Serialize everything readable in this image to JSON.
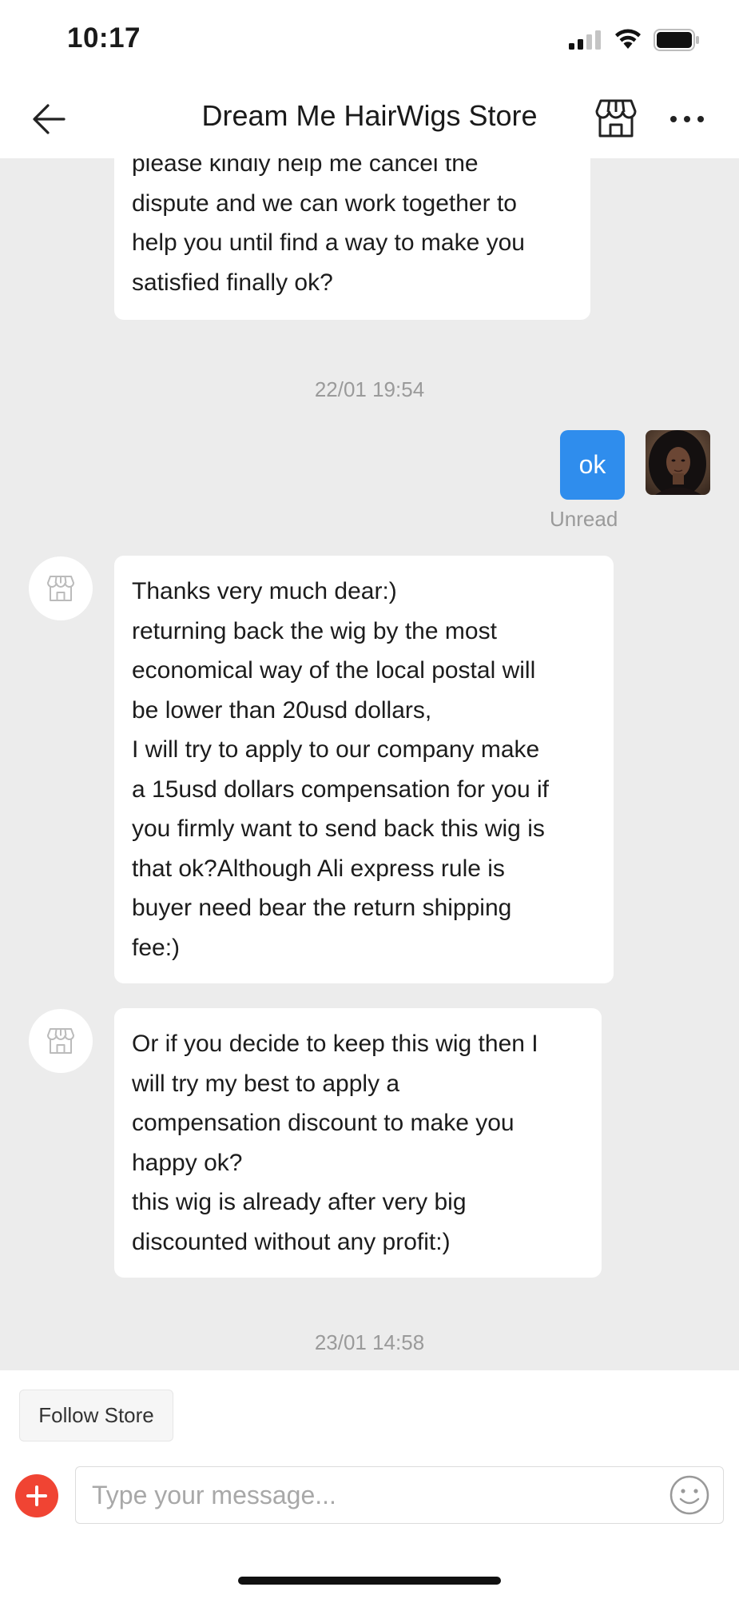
{
  "status_bar": {
    "time": "10:17"
  },
  "header": {
    "title": "Dream Me HairWigs Store",
    "back_icon": "arrow-left-icon",
    "store_icon": "storefront-icon",
    "more_icon": "more-horizontal-icon"
  },
  "messages": [
    {
      "from": "store",
      "text": "please kindly help me cancel the\ndispute and we can work together to\nhelp you until find a way to make you\nsatisfied finally ok?"
    },
    {
      "type": "timestamp",
      "text": "22/01 19:54"
    },
    {
      "from": "me",
      "text": "ok",
      "status": "Unread"
    },
    {
      "from": "store",
      "text": "Thanks very much dear:)\nreturning back the wig by the most\neconomical way of the local postal will\nbe lower than 20usd dollars,\nI will try to apply to our company make\na 15usd dollars compensation for you if\nyou firmly want to send back this wig is\nthat ok?Although Ali express rule is\nbuyer need bear the return shipping\nfee:)"
    },
    {
      "from": "store",
      "text": "Or if you decide to keep this wig then I\nwill try my best to apply a\ncompensation discount to make you\nhappy ok?\nthis wig is already after very big\ndiscounted without any profit:)"
    },
    {
      "type": "timestamp",
      "text": "23/01 14:58"
    }
  ],
  "footer": {
    "follow_label": "Follow Store",
    "input_placeholder": "Type your message...",
    "add_icon": "plus-circle-icon",
    "emoji_icon": "smiley-icon"
  },
  "colors": {
    "chat_background": "#ececec",
    "my_bubble": "#2f8ded",
    "add_button": "#f04433"
  }
}
